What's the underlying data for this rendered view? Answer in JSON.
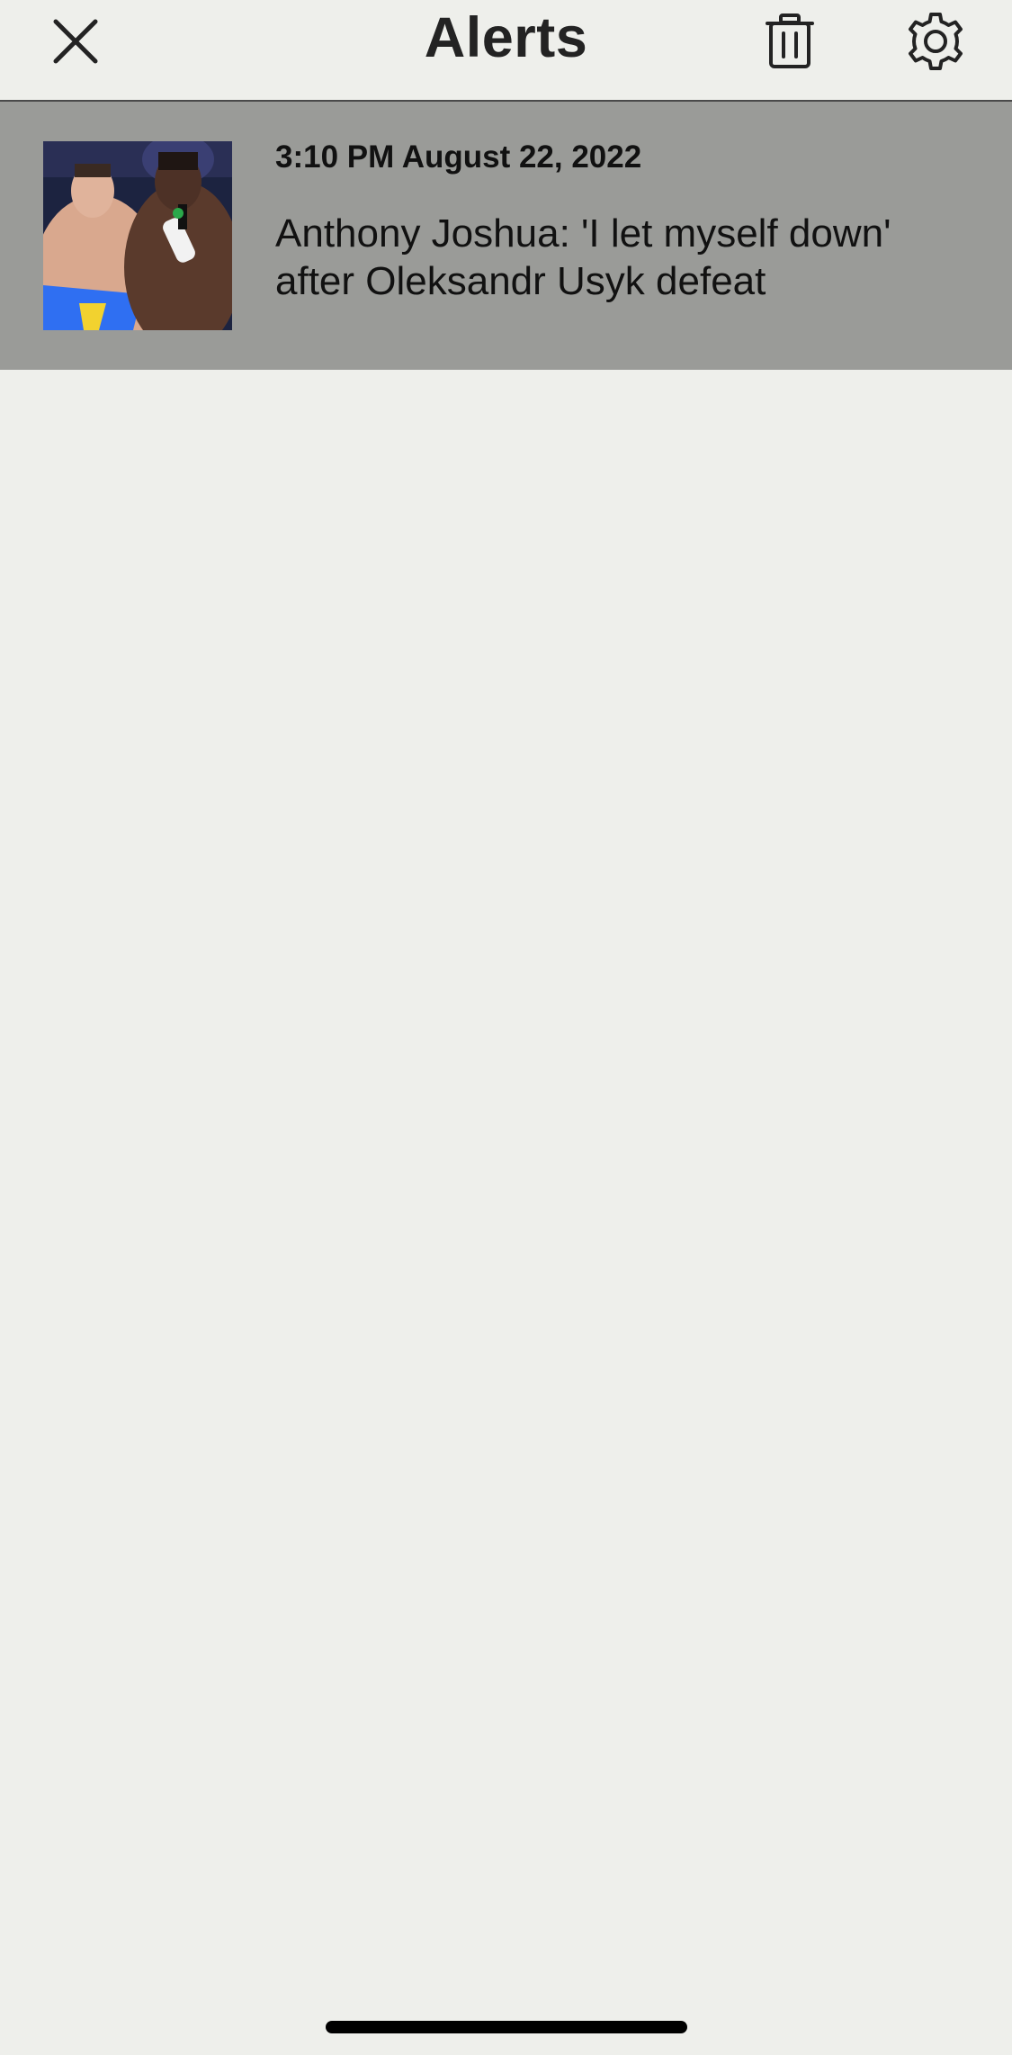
{
  "header": {
    "title": "Alerts",
    "close_icon": "close-icon",
    "trash_icon": "trash-icon",
    "settings_icon": "gear-icon"
  },
  "alerts": [
    {
      "timestamp": "3:10 PM August 22, 2022",
      "headline": "Anthony Joshua: 'I let myself down' after Oleksandr Usyk defeat",
      "thumbnail": "boxers-photo-thumbnail"
    }
  ],
  "colors": {
    "background": "#eeefeb",
    "alert_row_background": "#9a9b98",
    "text": "#111111",
    "title": "#232323"
  }
}
